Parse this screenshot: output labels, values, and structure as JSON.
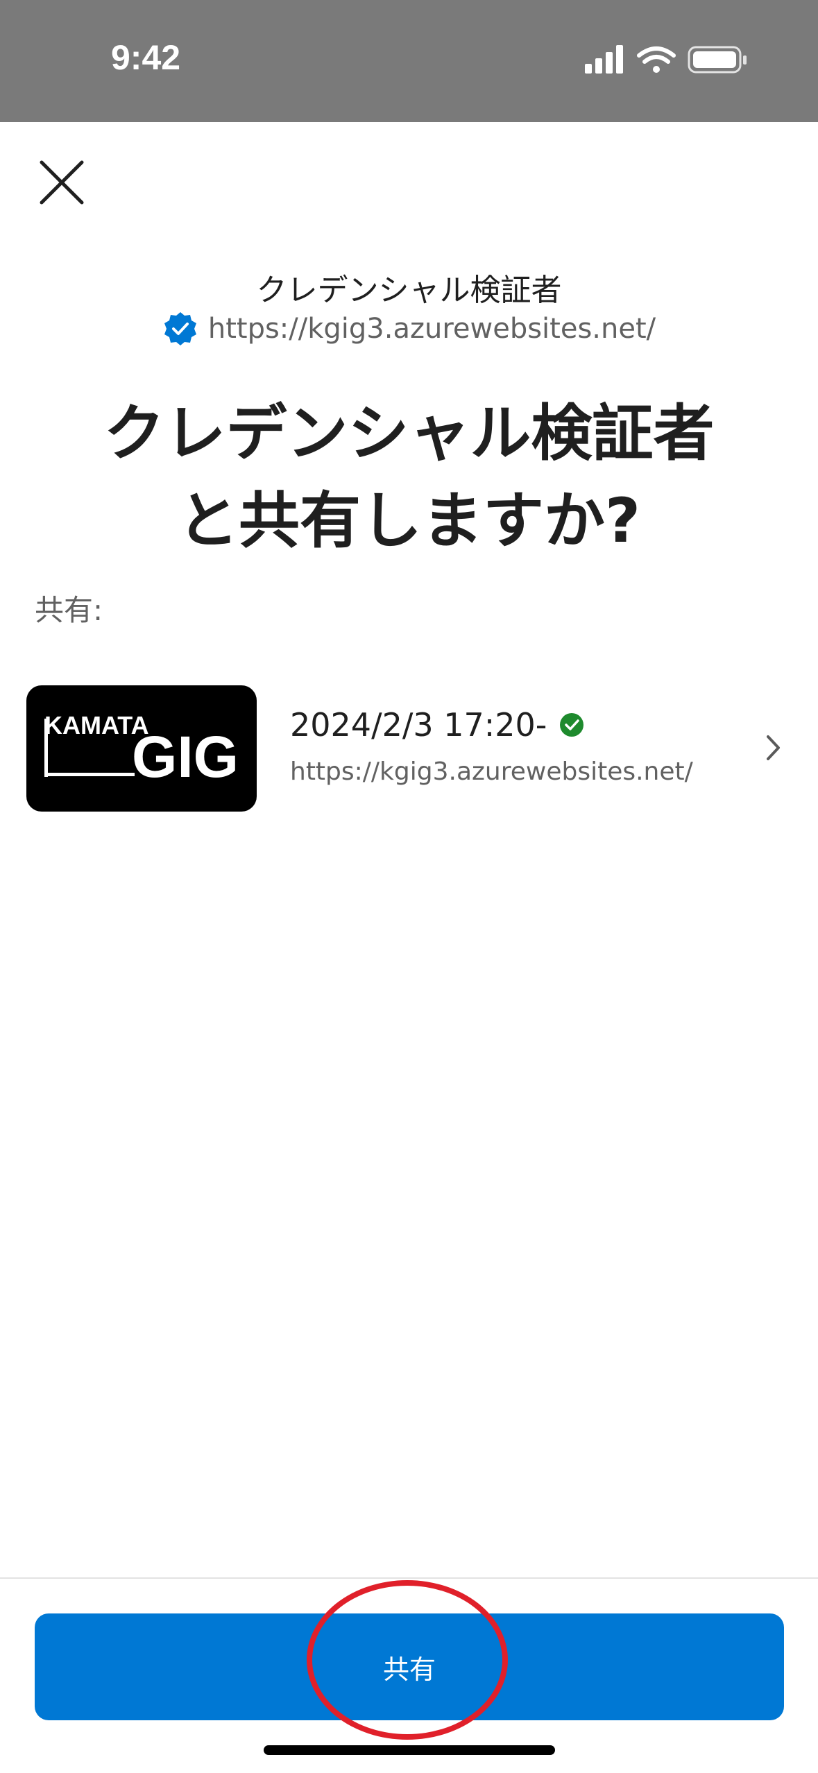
{
  "status_bar": {
    "time": "9:42",
    "icons": [
      "signal-icon",
      "wifi-icon",
      "battery-icon"
    ]
  },
  "header": {
    "close_icon": "close-icon"
  },
  "verifier": {
    "name": "クレデンシャル検証者",
    "url": "https://kgig3.azurewebsites.net/",
    "badge_icon": "verified-badge-icon"
  },
  "headline": {
    "line1": "クレデンシャル検証者",
    "line2": "と共有しますか?"
  },
  "share_section": {
    "label": "共有:"
  },
  "credential_card": {
    "logo_text_top": "KAMATA",
    "logo_text_main": "GIG",
    "date": "2024/2/3 17:20-",
    "url": "https://kgig3.azurewebsites.net/",
    "status_icon": "check-circle-icon",
    "chevron_icon": "chevron-right-icon"
  },
  "footer": {
    "share_button_label": "共有"
  },
  "colors": {
    "accent": "#0078d4",
    "verified_green": "#1e8a2d",
    "annotation_red": "#e0202a",
    "status_bar_bg": "#7a7a7a"
  }
}
